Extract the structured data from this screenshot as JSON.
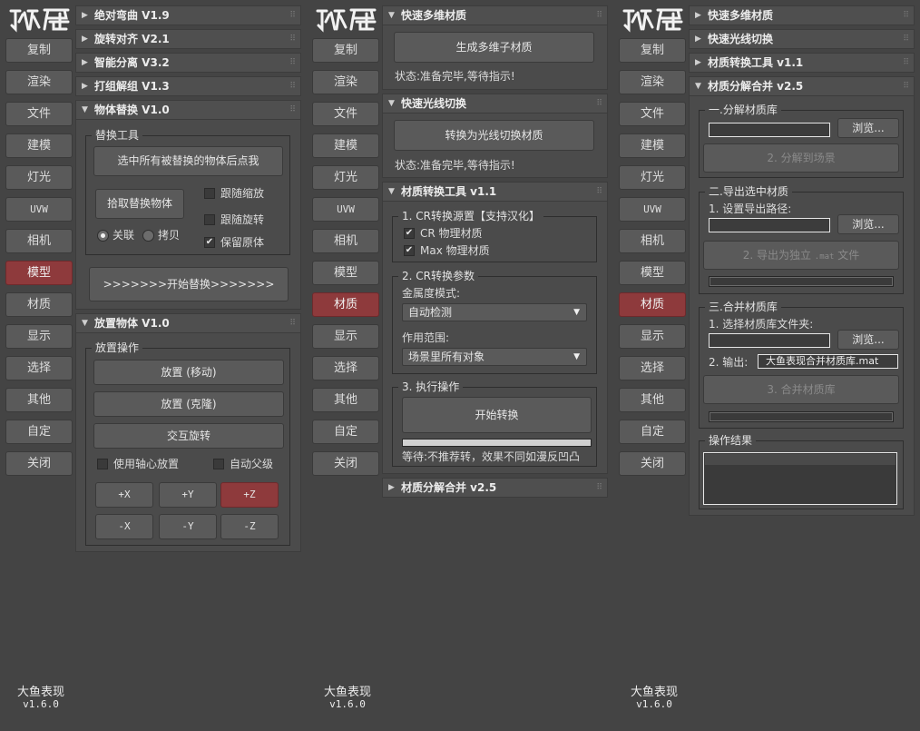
{
  "sidebar": {
    "items": [
      "复制",
      "渲染",
      "文件",
      "建模",
      "灯光",
      "UVW",
      "相机",
      "模型",
      "材质",
      "显示",
      "选择",
      "其他",
      "自定",
      "关闭"
    ],
    "active_panel1": "模型",
    "active_panel2": "材质",
    "active_panel3": "材质",
    "brand_name": "大鱼表现",
    "brand_version": "v1.6.0"
  },
  "panel1": {
    "rollouts": [
      {
        "title": "绝对弯曲  V1.9",
        "state": "collapsed"
      },
      {
        "title": "旋转对齐  V2.1",
        "state": "collapsed"
      },
      {
        "title": "智能分离  V3.2",
        "state": "collapsed"
      },
      {
        "title": "打组解组  V1.3",
        "state": "collapsed"
      },
      {
        "title": "物体替换  V1.0",
        "state": "expanded"
      }
    ],
    "replace": {
      "group_label": "替换工具",
      "select_button": "选中所有被替换的物体后点我",
      "pick_button": "拾取替换物体",
      "follow_scale": "跟随缩放",
      "follow_rotate": "跟随旋转",
      "keep_original": "保留原体",
      "radio_link": "关联",
      "radio_copy": "拷贝",
      "start_button": ">>>>>>>开始替换>>>>>>>"
    },
    "place": {
      "title": "放置物体  V1.0",
      "group_label": "放置操作",
      "move_button": "放置 (移动)",
      "clone_button": "放置 (克隆)",
      "rotate_button": "交互旋转",
      "use_pivot": "使用轴心放置",
      "auto_parent": "自动父级",
      "axes": [
        "+X",
        "+Y",
        "+Z",
        "-X",
        "-Y",
        "-Z"
      ],
      "active_axis": "+Z"
    }
  },
  "panel2": {
    "multi_sub": {
      "title": "快速多维材质",
      "button": "生成多维子材质",
      "status": "状态:准备完毕,等待指示!"
    },
    "light_switch": {
      "title": "快速光线切换",
      "button": "转换为光线切换材质",
      "status": "状态:准备完毕,等待指示!"
    },
    "convert": {
      "title": "材质转换工具  v1.1",
      "group1_label": "1. CR转换源置【支持汉化】",
      "cr_material": "CR 物理材质",
      "max_material": "Max 物理材质",
      "group2_label": "2. CR转换参数",
      "metal_label": "金属度模式:",
      "metal_value": "自动检测",
      "scope_label": "作用范围:",
      "scope_value": "场景里所有对象",
      "group3_label": "3. 执行操作",
      "start_button": "开始转换",
      "progress": 1.0,
      "wait_text": "等待:不推荐转，效果不同如漫反凹凸"
    },
    "split_merge_collapsed": "材质分解合并  v2.5"
  },
  "panel3": {
    "rollouts": [
      {
        "title": "快速多维材质",
        "state": "collapsed"
      },
      {
        "title": "快速光线切换",
        "state": "collapsed"
      },
      {
        "title": "材质转换工具  v1.1",
        "state": "collapsed"
      },
      {
        "title": "材质分解合并  v2.5",
        "state": "expanded"
      }
    ],
    "split": {
      "group_label": "一.分解材质库",
      "path_value": "",
      "browse": "浏览...",
      "action": "2. 分解到场景"
    },
    "export": {
      "group_label": "二.导出选中材质",
      "path_label": "1. 设置导出路径:",
      "path_value": "",
      "browse": "浏览...",
      "action_prefix": "2. 导出为独立",
      "action_ext": ".mat",
      "action_suffix": "文件",
      "progress": 0.0
    },
    "merge": {
      "group_label": "三.合并材质库",
      "folder_label": "1. 选择材质库文件夹:",
      "folder_value": "",
      "browse": "浏览...",
      "output_label": "2. 输出:",
      "output_value": "大鱼表现合并材质库.mat",
      "action": "3. 合并材质库",
      "progress": 0.0
    },
    "result": {
      "group_label": "操作结果"
    }
  },
  "colors": {
    "background": "#444444",
    "active_red": "#8e3a3c",
    "button": "#5a5a5a"
  }
}
